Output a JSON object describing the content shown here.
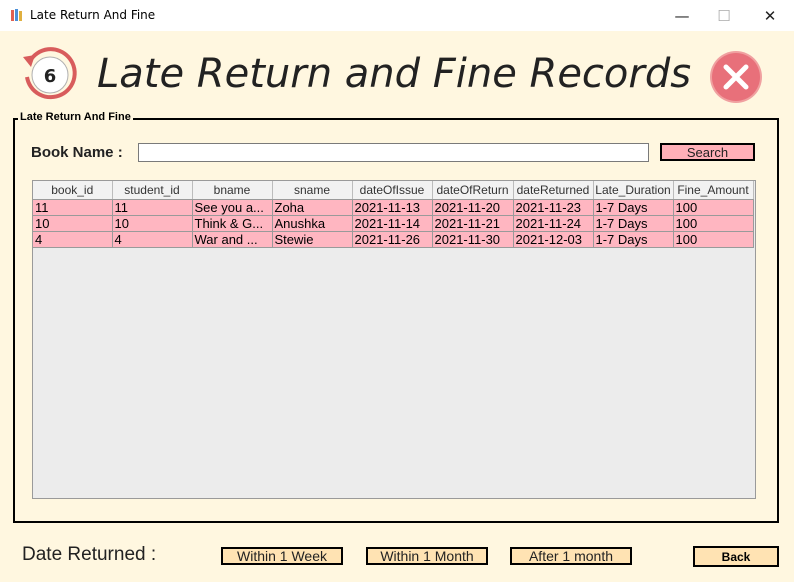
{
  "window": {
    "title": "Late Return And Fine"
  },
  "header": {
    "title": "Late Return and Fine Records",
    "clock_number": "6"
  },
  "group": {
    "legend": "Late Return And Fine"
  },
  "search": {
    "label": "Book Name :",
    "value": "",
    "button_label": "Search"
  },
  "table": {
    "columns": [
      "book_id",
      "student_id",
      "bname",
      "sname",
      "dateOfIssue",
      "dateOfReturn",
      "dateReturned",
      "Late_Duration",
      "Fine_Amount"
    ],
    "rows": [
      [
        "11",
        "11",
        "See you a...",
        "Zoha",
        "2021-11-13",
        "2021-11-20",
        "2021-11-23",
        "1-7 Days",
        "100"
      ],
      [
        "10",
        "10",
        "Think & G...",
        "Anushka",
        "2021-11-14",
        "2021-11-21",
        "2021-11-24",
        "1-7 Days",
        "100"
      ],
      [
        "4",
        "4",
        "War and ...",
        "Stewie",
        "2021-11-26",
        "2021-11-30",
        "2021-12-03",
        "1-7 Days",
        "100"
      ]
    ]
  },
  "footer": {
    "label": "Date Returned :",
    "filters": [
      "Within 1 Week",
      "Within 1 Month",
      "After 1 month"
    ],
    "back_label": "Back"
  },
  "colors": {
    "background": "#fff7e0",
    "row": "#ffb6c1",
    "search_button": "#ffb0b8",
    "filter_button": "#ffe3b3",
    "close_icon": "#e8707a"
  }
}
